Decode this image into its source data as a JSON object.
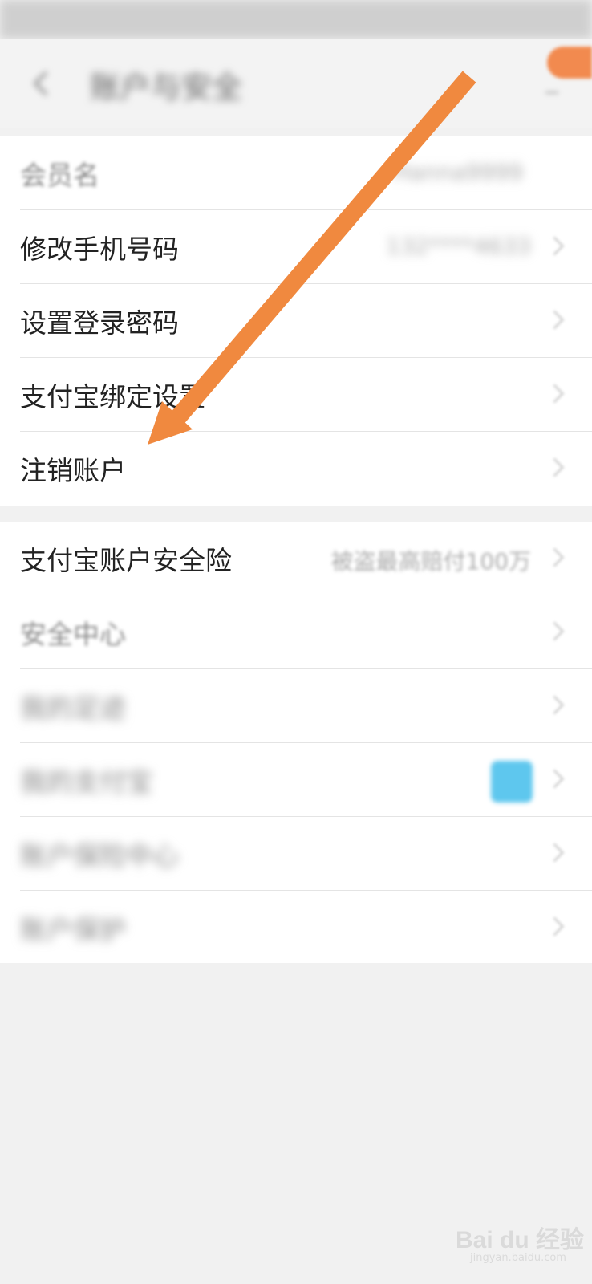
{
  "nav": {
    "title": "账户与安全"
  },
  "group1": {
    "rows": [
      {
        "label": "会员名",
        "value": "Hanna9999"
      },
      {
        "label": "修改手机号码",
        "value": "132****4633"
      },
      {
        "label": "设置登录密码",
        "value": ""
      },
      {
        "label": "支付宝绑定设置",
        "value": ""
      },
      {
        "label": "注销账户",
        "value": ""
      }
    ]
  },
  "group2": {
    "rows": [
      {
        "label": "支付宝账户安全险",
        "value": "被盗最高赔付100万"
      },
      {
        "label": "安全中心",
        "value": ""
      },
      {
        "label": "我的足迹",
        "value": ""
      },
      {
        "label": "我的支付宝",
        "value": ""
      },
      {
        "label": "账户保险中心",
        "value": ""
      },
      {
        "label": "账户保护",
        "value": ""
      }
    ]
  },
  "annotation": {
    "arrow_color": "#f0893f"
  },
  "watermark": {
    "brand": "Bai du 经验",
    "url": "jingyan.baidu.com"
  }
}
